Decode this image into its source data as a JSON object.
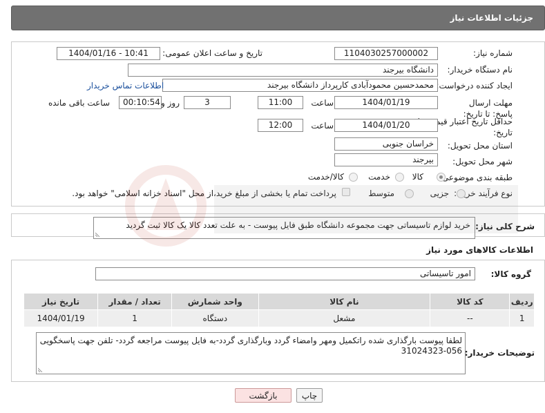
{
  "header": {
    "title": "جزئیات اطلاعات نیاز"
  },
  "form": {
    "need_number_label": "شماره نیاز:",
    "need_number": "1104030257000002",
    "announce_label": "تاریخ و ساعت اعلان عمومی:",
    "announce_value": "1404/01/16 - 10:41",
    "buyer_org_label": "نام دستگاه خریدار:",
    "buyer_org": "دانشگاه بیرجند",
    "requester_label": "ایجاد کننده درخواست:",
    "requester": "محمدحسین محمودآبادی کارپرداز دانشگاه بیرجند",
    "contact_link": "اطلاعات تماس خریدار",
    "deadline_label": "مهلت ارسال پاسخ: تا تاریخ:",
    "deadline_date": "1404/01/19",
    "time_label": "ساعت",
    "deadline_time": "11:00",
    "days_count": "3",
    "days_label": "روز و",
    "remaining_time": "00:10:54",
    "remaining_label": "ساعت باقی مانده",
    "price_validity_label": "حداقل تاریخ اعتبار قیمت: تا تاریخ:",
    "price_validity_date": "1404/01/20",
    "price_validity_time": "12:00",
    "province_label": "استان محل تحویل:",
    "province": "خراسان جنوبی",
    "city_label": "شهر محل تحویل:",
    "city": "بیرجند",
    "category_label": "طبقه بندی موضوعی:",
    "category_options": [
      "کالا",
      "خدمت",
      "کالا/خدمت"
    ],
    "process_label": "نوع فرآیند خرید :",
    "process_options": [
      "جزیی",
      "متوسط"
    ],
    "payment_note": "پرداخت تمام یا بخشی از مبلغ خرید،از محل \"اسناد خزانه اسلامی\" خواهد بود."
  },
  "description": {
    "label": "شرح کلی نیاز:",
    "text": "خرید لوازم تاسیساتی جهت مجموعه دانشگاه طبق فایل پیوست - به علت تعدد کالا یک کالا ثبت گردید"
  },
  "goods": {
    "section_title": "اطلاعات کالاهای مورد نیاز",
    "group_label": "گروه کالا:",
    "group_value": "امور تاسیساتی",
    "columns": [
      "ردیف",
      "کد کالا",
      "نام کالا",
      "واحد شمارش",
      "تعداد / مقدار",
      "تاریخ نیاز"
    ],
    "rows": [
      [
        "1",
        "--",
        "مشعل",
        "دستگاه",
        "1",
        "1404/01/19"
      ]
    ]
  },
  "buyer_notes": {
    "label": "توضیحات خریدار:",
    "text": "لطفا پیوست بارگذاری شده راتکمیل ومهر وامضاء گردد وبارگذاری گردد-به فایل پیوست مراجعه گردد- تلفن جهت پاسخگویی 056-31024323"
  },
  "buttons": {
    "print": "چاپ",
    "back": "بازگشت"
  },
  "colors": {
    "header_bg": "#717171",
    "link": "#1a4f9c",
    "back_button_bg": "#fbe2e2"
  }
}
